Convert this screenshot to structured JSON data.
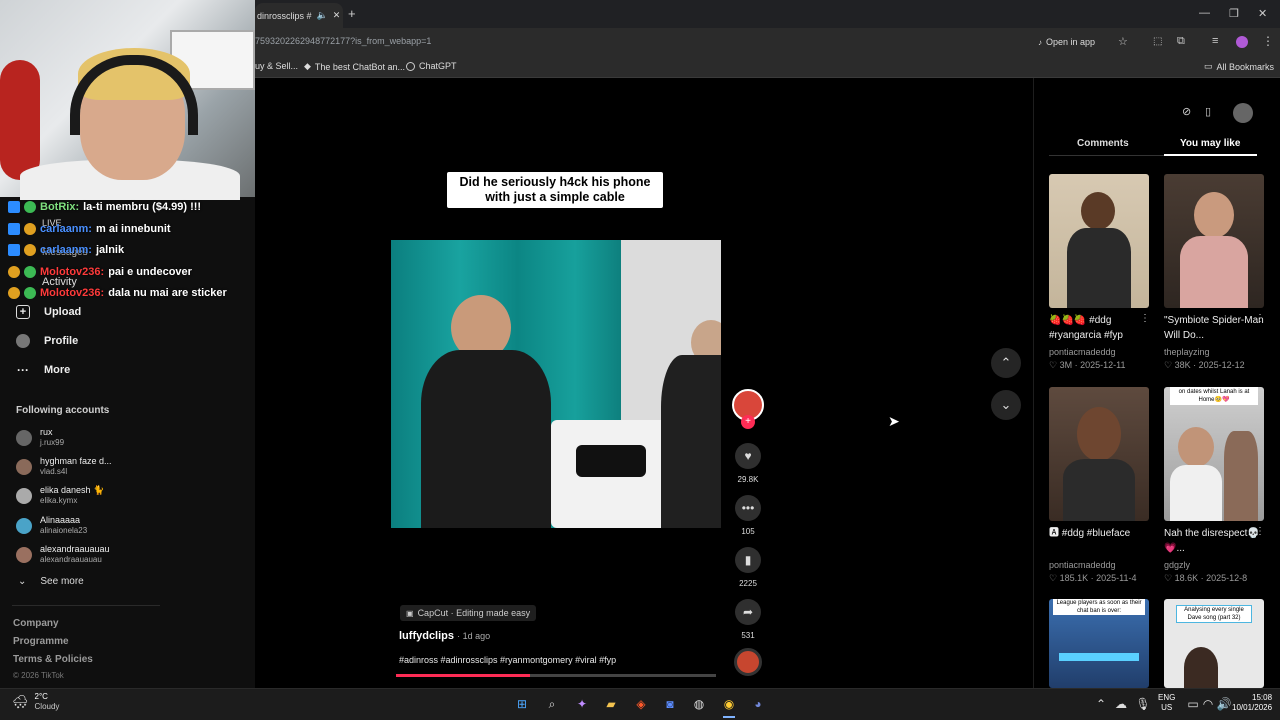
{
  "browser": {
    "tab_title": "dinrossclips #",
    "url": "7593202262948772177?is_from_webapp=1",
    "open_in_app": "Open in app",
    "bookmarks": [
      "uy & Sell...",
      "The best ChatBot an...",
      "ChatGPT"
    ],
    "all_bookmarks": "All Bookmarks"
  },
  "stream_chat": [
    {
      "user": "BotRix:",
      "text": "la-ti membru ($4.99) !!!",
      "color": "#7fe07f"
    },
    {
      "user": "carlaanm:",
      "text": "m ai innebunit",
      "color": "#4a90ff"
    },
    {
      "user": "carlaanm:",
      "text": "jalnik",
      "color": "#4a90ff"
    },
    {
      "user": "Molotov236:",
      "text": "pai e undecover",
      "color": "#ff3b3b"
    },
    {
      "user": "Molotov236:",
      "text": "dala nu mai are sticker",
      "color": "#ff3b3b"
    }
  ],
  "overlay_words": {
    "live": "LIVE",
    "messages": "Messages",
    "activity": "Activity"
  },
  "sidebar": {
    "nav": [
      {
        "label": "Upload",
        "icon": "plus-icon"
      },
      {
        "label": "Profile",
        "icon": "avatar-icon"
      },
      {
        "label": "More",
        "icon": "more-icon"
      }
    ],
    "following_title": "Following accounts",
    "accounts": [
      {
        "name": "rux",
        "handle": "j.rux99"
      },
      {
        "name": "hyghman faze d...",
        "handle": "vlad.s4l"
      },
      {
        "name": "elika danesh 🐈",
        "handle": "elika.kymx"
      },
      {
        "name": "Alinaaaaa",
        "handle": "alinaionela23"
      },
      {
        "name": "alexandraauauau",
        "handle": "alexandraauauau"
      }
    ],
    "see_more": "See more",
    "footer": [
      "Company",
      "Programme",
      "Terms & Policies"
    ],
    "copyright": "© 2026 TikTok"
  },
  "video": {
    "caption_line1": "Did he seriously h4ck his phone",
    "caption_line2": "with just a simple cable",
    "capcut": "CapCut · Editing made easy",
    "author": "luffydclips",
    "age": "· 1d ago",
    "hashtags": "#adinross #adinrossclips #ryanmontgomery #viral #fyp",
    "likes": "29.8K",
    "comments": "105",
    "saves": "2225",
    "shares": "531",
    "progress": 0.42
  },
  "right_panel": {
    "tabs": [
      "Comments",
      "You may like"
    ],
    "active_tab": "You may like",
    "items": [
      {
        "title": "🍓🍓🍓 #ddg #ryangarcia #fyp",
        "author": "pontiacmadeddg",
        "likes": "3M",
        "date": "2025-12-11"
      },
      {
        "title": "\"Symbiote Spider-Man Will Do...",
        "author": "theplayzing",
        "likes": "38K",
        "date": "2025-12-12"
      },
      {
        "title": "🅰 #ddg #blueface",
        "author": "pontiacmadeddg",
        "likes": "185.1K",
        "date": "2025-11-4"
      },
      {
        "title": "Nah the disrespect💀💗...",
        "author": "gdgzly",
        "likes": "18.6K",
        "date": "2025-12-8"
      }
    ],
    "thumb_text_4": "on dates whilst Lanah is at Home🥺💖",
    "thumb_text_5": "League players as soon as their chat ban is over:",
    "thumb_text_6": "Analysing every single Dave song (part 32)"
  },
  "taskbar": {
    "temp": "2°C",
    "weather": "Cloudy",
    "lang": "ENG",
    "region": "US",
    "time": "15:08",
    "date": "10/01/2026"
  }
}
